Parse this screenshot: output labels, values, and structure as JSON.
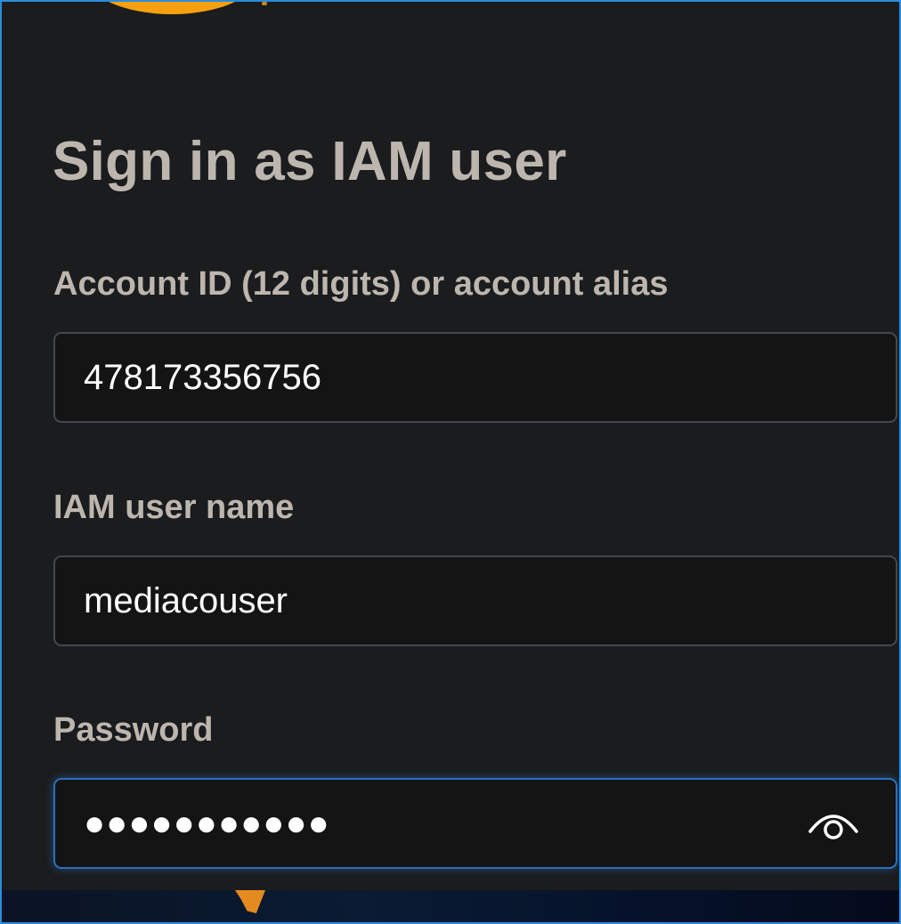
{
  "page": {
    "title": "Sign in as IAM user"
  },
  "form": {
    "account": {
      "label": "Account ID (12 digits) or account alias",
      "value": "478173356756"
    },
    "username": {
      "label": "IAM user name",
      "value": "mediacouser"
    },
    "password": {
      "label": "Password",
      "masked_value": "●●●●●●●●●●●",
      "toggle_icon": "eye-icon"
    }
  },
  "colors": {
    "background": "#1b1c1e",
    "input_background": "#141414",
    "label_text": "#bdb6af",
    "focus_border": "#2b6fbf",
    "logo_accent": "#f5a00f"
  }
}
